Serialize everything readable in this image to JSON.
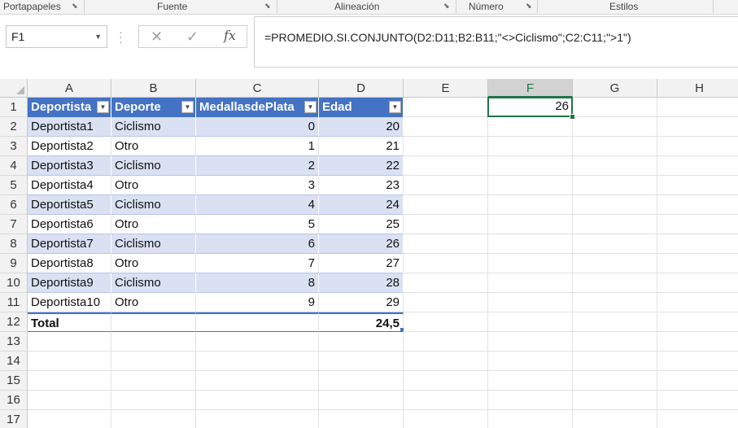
{
  "ribbon": {
    "groups": [
      {
        "label": "Portapapeles"
      },
      {
        "label": "Fuente"
      },
      {
        "label": "Alineación"
      },
      {
        "label": "Número"
      },
      {
        "label": "Estilos"
      }
    ]
  },
  "formula_bar": {
    "name_box": "F1",
    "cancel_icon": "✕",
    "enter_icon": "✓",
    "fx_label": "fx",
    "formula": "=PROMEDIO.SI.CONJUNTO(D2:D11;B2:B11;\"<>Ciclismo\";C2:C11;\">1\")"
  },
  "grid": {
    "columns": [
      "A",
      "B",
      "C",
      "D",
      "E",
      "F",
      "G",
      "H"
    ],
    "selected_column": "F",
    "rows": [
      "1",
      "2",
      "3",
      "4",
      "5",
      "6",
      "7",
      "8",
      "9",
      "10",
      "11",
      "12",
      "13",
      "14",
      "15",
      "16",
      "17"
    ],
    "selected_row": "1",
    "selected_cell": {
      "ref": "F1",
      "value": "26"
    }
  },
  "table": {
    "headers": [
      "Deportista",
      "Deporte",
      "MedallasdePlata",
      "Edad"
    ],
    "rows": [
      [
        "Deportista1",
        "Ciclismo",
        "0",
        "20"
      ],
      [
        "Deportista2",
        "Otro",
        "1",
        "21"
      ],
      [
        "Deportista3",
        "Ciclismo",
        "2",
        "22"
      ],
      [
        "Deportista4",
        "Otro",
        "3",
        "23"
      ],
      [
        "Deportista5",
        "Ciclismo",
        "4",
        "24"
      ],
      [
        "Deportista6",
        "Otro",
        "5",
        "25"
      ],
      [
        "Deportista7",
        "Ciclismo",
        "6",
        "26"
      ],
      [
        "Deportista8",
        "Otro",
        "7",
        "27"
      ],
      [
        "Deportista9",
        "Ciclismo",
        "8",
        "28"
      ],
      [
        "Deportista10",
        "Otro",
        "9",
        "29"
      ]
    ],
    "total": {
      "label": "Total",
      "value": "24,5"
    },
    "colors": {
      "header": "#4472c4",
      "band": "#d9e1f2"
    }
  }
}
